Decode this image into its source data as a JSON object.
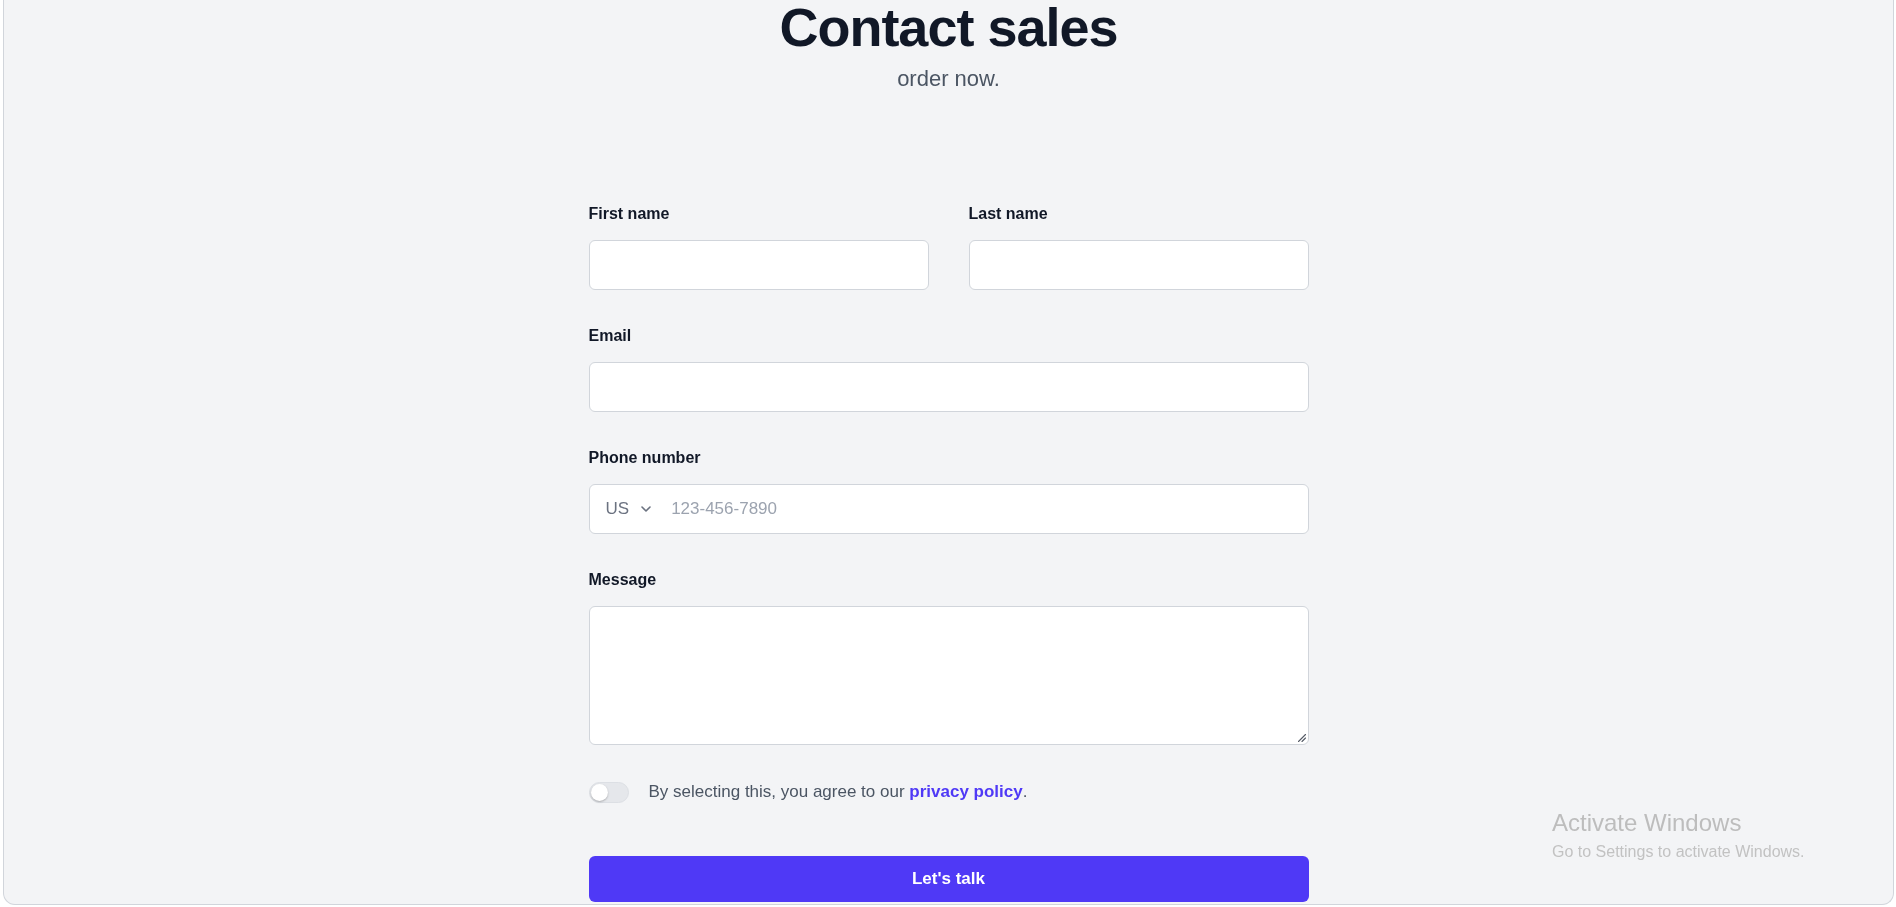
{
  "header": {
    "title": "Contact sales",
    "subtitle": "order now."
  },
  "form": {
    "rows": [
      {
        "fields": [
          {
            "kind": "text",
            "label": "First name"
          },
          {
            "kind": "text",
            "label": "Last name"
          }
        ]
      },
      {
        "fields": [
          {
            "kind": "text",
            "label": "Email"
          }
        ]
      },
      {
        "fields": [
          {
            "kind": "phone",
            "label": "Phone number",
            "country": "US",
            "placeholder": "123-456-7890"
          }
        ]
      },
      {
        "fields": [
          {
            "kind": "textarea",
            "label": "Message"
          }
        ]
      }
    ],
    "agreement": {
      "on": false,
      "text": "By selecting this, you agree to our",
      "link": "privacy policy",
      "end": "."
    },
    "submit": {
      "label": "Let's talk"
    }
  },
  "system_notice": {
    "title": "Activate Windows",
    "text": "Go to Settings to activate Windows."
  }
}
